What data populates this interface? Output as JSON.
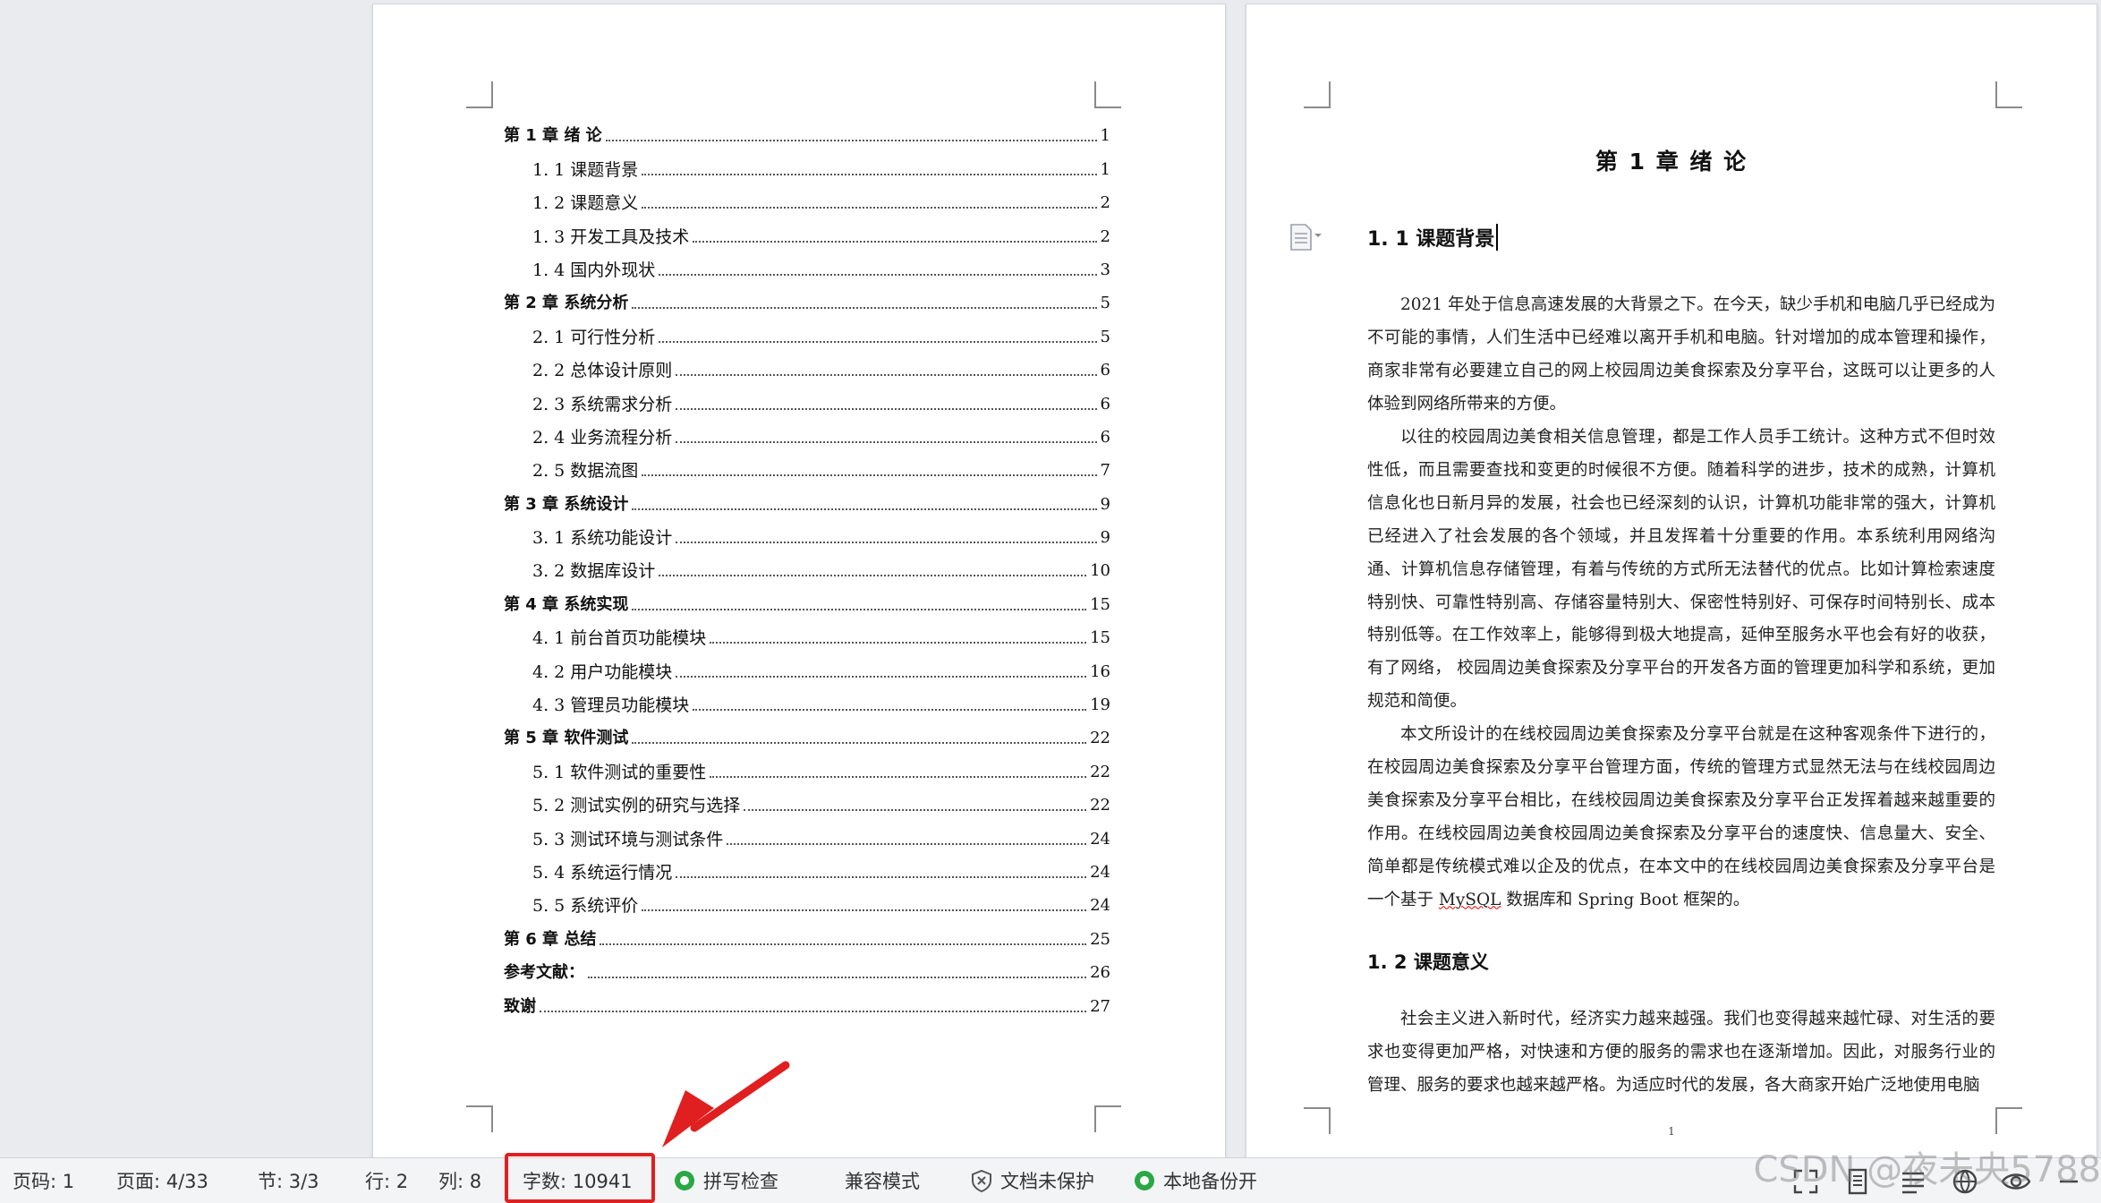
{
  "toc": [
    {
      "level": 1,
      "title": "第 1 章  绪    论",
      "page": "1"
    },
    {
      "level": 2,
      "title": "1. 1 课题背景",
      "page": "1"
    },
    {
      "level": 2,
      "title": "1. 2  课题意义",
      "page": "2"
    },
    {
      "level": 2,
      "title": "1. 3  开发工具及技术",
      "page": "2"
    },
    {
      "level": 2,
      "title": "1. 4  国内外现状",
      "page": "3"
    },
    {
      "level": 1,
      "title": "第 2 章  系统分析",
      "page": "5"
    },
    {
      "level": 2,
      "title": "2. 1  可行性分析",
      "page": "5"
    },
    {
      "level": 2,
      "title": "2. 2 总体设计原则",
      "page": "6"
    },
    {
      "level": 2,
      "title": "2. 3  系统需求分析",
      "page": "6"
    },
    {
      "level": 2,
      "title": "2. 4  业务流程分析",
      "page": "6"
    },
    {
      "level": 2,
      "title": "2. 5  数据流图",
      "page": "7"
    },
    {
      "level": 1,
      "title": "第 3 章  系统设计",
      "page": "9"
    },
    {
      "level": 2,
      "title": "3. 1  系统功能设计",
      "page": "9"
    },
    {
      "level": 2,
      "title": "3. 2  数据库设计",
      "page": "10"
    },
    {
      "level": 1,
      "title": "第 4 章  系统实现",
      "page": "15"
    },
    {
      "level": 2,
      "title": "4. 1 前台首页功能模块",
      "page": "15"
    },
    {
      "level": 2,
      "title": "4. 2 用户功能模块",
      "page": "16"
    },
    {
      "level": 2,
      "title": "4. 3 管理员功能模块",
      "page": "19"
    },
    {
      "level": 1,
      "title": "第 5 章  软件测试",
      "page": "22"
    },
    {
      "level": 2,
      "title": "5. 1 软件测试的重要性",
      "page": "22"
    },
    {
      "level": 2,
      "title": "5. 2 测试实例的研究与选择",
      "page": "22"
    },
    {
      "level": 2,
      "title": "5. 3 测试环境与测试条件",
      "page": "24"
    },
    {
      "level": 2,
      "title": "5. 4 系统运行情况",
      "page": "24"
    },
    {
      "level": 2,
      "title": "5. 5 系统评价",
      "page": "24"
    },
    {
      "level": 1,
      "title": "第 6 章  总结",
      "page": "25"
    },
    {
      "level": 1,
      "title": "参考文献：",
      "page": "26"
    },
    {
      "level": 1,
      "title": "致谢",
      "page": "27"
    }
  ],
  "document": {
    "chapter_title": "第 1 章   绪    论",
    "section_1_1": "1. 1 课题背景",
    "para1": "2021 年处于信息高速发展的大背景之下。在今天，缺少手机和电脑几乎已经成为不可能的事情，人们生活中已经难以离开手机和电脑。针对增加的成本管理和操作，商家非常有必要建立自己的网上校园周边美食探索及分享平台，这既可以让更多的人体验到网络所带来的方便。",
    "para2": "以往的校园周边美食相关信息管理，都是工作人员手工统计。这种方式不但时效性低，而且需要查找和变更的时候很不方便。随着科学的进步，技术的成熟，计算机信息化也日新月异的发展，社会也已经深刻的认识，计算机功能非常的强大，计算机已经进入了社会发展的各个领域，并且发挥着十分重要的作用。本系统利用网络沟通、计算机信息存储管理，有着与传统的方式所无法替代的优点。比如计算检索速度特别快、可靠性特别高、存储容量特别大、保密性特别好、可保存时间特别长、成本特别低等。在工作效率上，能够得到极大地提高，延伸至服务水平也会有好的收获，有了网络，  校园周边美食探索及分享平台的开发各方面的管理更加科学和系统，更加规范和简便。",
    "para3_a": "本文所设计的在线校园周边美食探索及分享平台就是在这种客观条件下进行的，在校园周边美食探索及分享平台管理方面，传统的管理方式显然无法与在线校园周边美食探索及分享平台相比，在线校园周边美食探索及分享平台正发挥着越来越重要的作用。在线校园周边美食校园周边美食探索及分享平台的速度快、信息量大、安全、简单都是传统模式难以企及的优点，在本文中的在线校园周边美食探索及分享平台是一个基于 ",
    "para3_spell": "MySQL",
    "para3_b": " 数据库和 Spring   Boot 框架的。",
    "section_1_2": "1. 2  课题意义",
    "para4": "社会主义进入新时代，经济实力越来越强。我们也变得越来越忙碌、对生活的要求也变得更加严格，对快速和方便的服务的需求也在逐渐增加。因此，对服务行业的管理、服务的要求也越来越严格。为适应时代的发展，各大商家开始广泛地使用电脑",
    "page_number": "1"
  },
  "statusbar": {
    "page_code": "页码: 1",
    "page": "页面: 4/33",
    "section": "节: 3/3",
    "row": "行: 2",
    "col": "列: 8",
    "word_count": "字数: 10941",
    "spell_check": "拼写检查",
    "compat_mode": "兼容模式",
    "doc_protect": "文档未保护",
    "local_backup": "本地备份开"
  },
  "watermark": "CSDN @夜未央5788",
  "colors": {
    "highlight": "#e02020",
    "accent_green": "#2aa845"
  }
}
